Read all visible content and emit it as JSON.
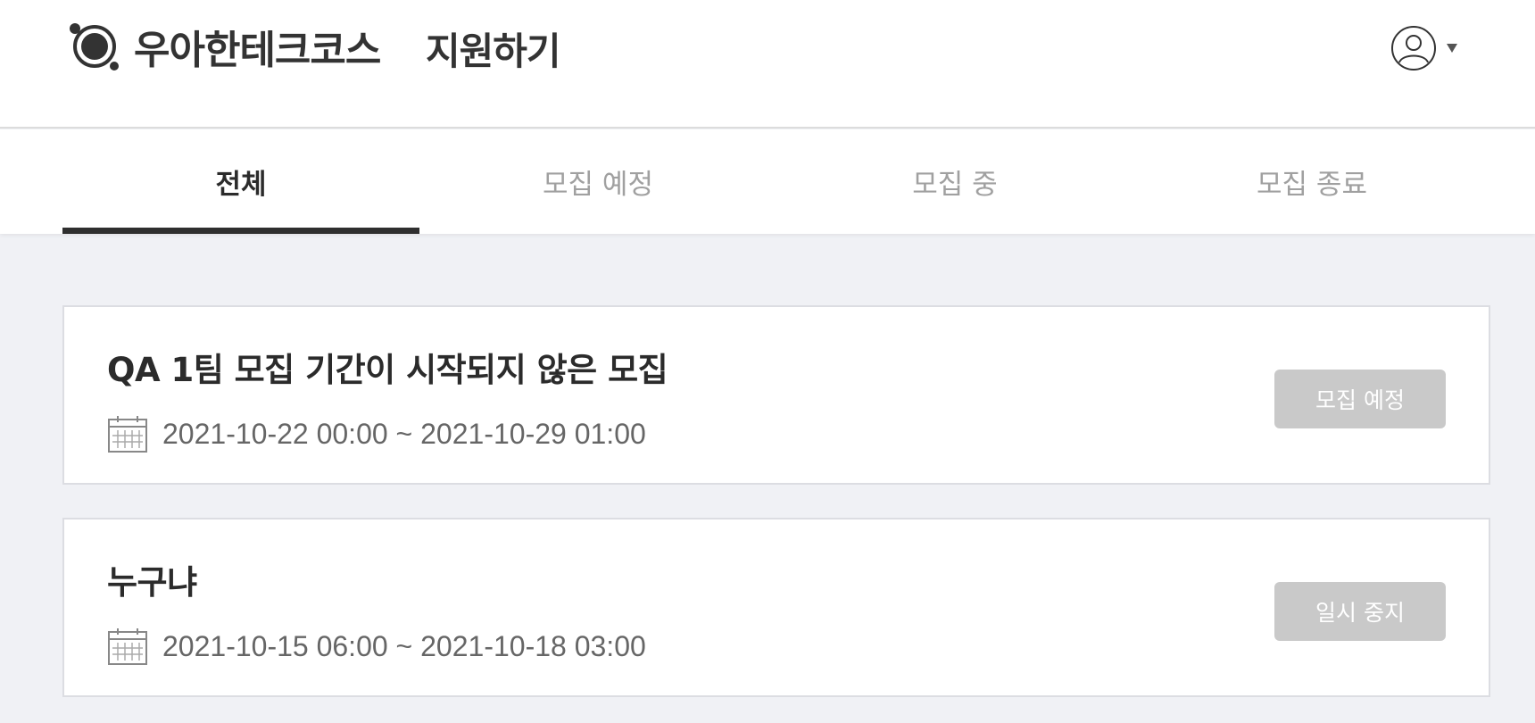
{
  "header": {
    "brand": "우아한테크코스",
    "page_title": "지원하기",
    "logo_icon": "planet-logo-icon",
    "profile_icon": "user-avatar-icon",
    "menu_icon": "caret-down-icon"
  },
  "tabs": [
    {
      "label": "전체",
      "active": true
    },
    {
      "label": "모집 예정",
      "active": false
    },
    {
      "label": "모집 중",
      "active": false
    },
    {
      "label": "모집 종료",
      "active": false
    }
  ],
  "recruitments": [
    {
      "title": "QA 1팀 모집 기간이 시작되지 않은 모집",
      "period": "2021-10-22 00:00 ~ 2021-10-29 01:00",
      "status_label": "모집 예정",
      "icon": "calendar-icon"
    },
    {
      "title": "누구냐",
      "period": "2021-10-15 06:00 ~ 2021-10-18 03:00",
      "status_label": "일시 중지",
      "icon": "calendar-icon"
    }
  ],
  "colors": {
    "background": "#f0f1f5",
    "active_tab_indicator": "#2f2f2f",
    "inactive_tab_text": "#a0a0a0",
    "status_button": "#c9c9c9"
  }
}
